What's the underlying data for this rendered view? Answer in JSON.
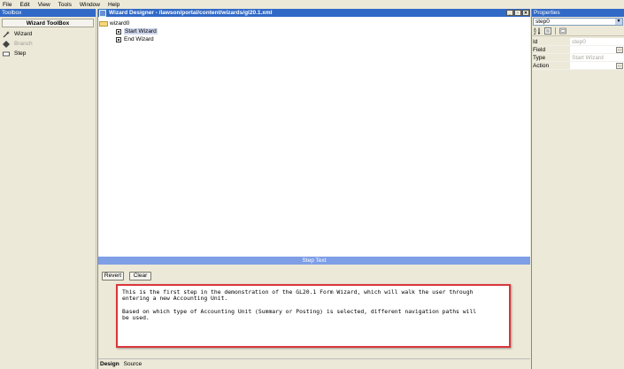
{
  "menubar": {
    "items": [
      "File",
      "Edit",
      "View",
      "Tools",
      "Window",
      "Help"
    ]
  },
  "toolbox": {
    "title": "Toolbox",
    "header": "Wizard ToolBox",
    "items": [
      {
        "label": "Wizard",
        "icon": "wand-icon",
        "enabled": true
      },
      {
        "label": "Branch",
        "icon": "branch-icon",
        "enabled": false
      },
      {
        "label": "Step",
        "icon": "step-icon",
        "enabled": true
      }
    ]
  },
  "designer": {
    "title": "Wizard Designer - /lawson/portal/content/wizards/gl20.1.xml",
    "tree": {
      "root": "wizard0",
      "children": [
        "Start Wizard",
        "End Wizard"
      ],
      "selected": "Start Wizard"
    },
    "step_text": {
      "title": "Step Text",
      "revert_label": "Revert",
      "clear_label": "Clear",
      "content": "This is the first step in the demonstration of the GL20.1 Form Wizard, which will walk the user through\nentering a new Accounting Unit.\n\nBased on which type of Accounting Unit (Summary or Posting) is selected, different navigation paths will\nbe used."
    },
    "tabs": [
      {
        "label": "Design",
        "active": true
      },
      {
        "label": "Source",
        "active": false
      }
    ]
  },
  "properties": {
    "title": "Properties",
    "selected_object": "step0",
    "rows": [
      {
        "key": "Id",
        "value": "step0",
        "has_button": false
      },
      {
        "key": "Field",
        "value": "",
        "has_button": true
      },
      {
        "key": "Type",
        "value": "Start Wizard",
        "has_button": false
      },
      {
        "key": "Action",
        "value": "",
        "has_button": true
      }
    ]
  },
  "colors": {
    "title_bar": "#3169c6",
    "step_text_bar": "#7e9ee6",
    "highlight_border": "#d9363b",
    "chrome": "#ece9d8"
  }
}
